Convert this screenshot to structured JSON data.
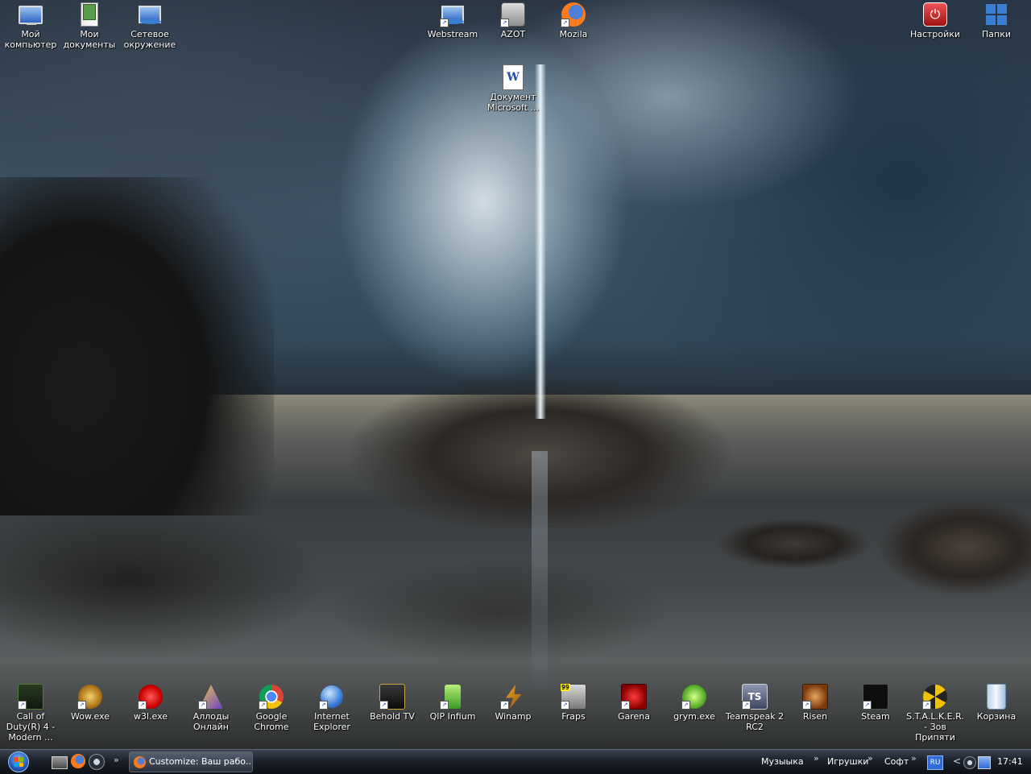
{
  "desktop": {
    "icons_top": [
      {
        "label": "Мой компьютер",
        "icon": "my-computer-icon"
      },
      {
        "label": "Мои документы",
        "icon": "my-documents-icon"
      },
      {
        "label": "Сетевое окружение",
        "icon": "network-icon"
      },
      {
        "label": "Webstream",
        "icon": "webstream-icon"
      },
      {
        "label": "AZOT",
        "icon": "azot-icon"
      },
      {
        "label": "Mozila",
        "icon": "firefox-icon"
      },
      {
        "label": "Документ Microsoft ...",
        "icon": "word-document-icon"
      },
      {
        "label": "Настройки",
        "icon": "power-settings-icon"
      },
      {
        "label": "Папки",
        "icon": "windows-folders-icon"
      }
    ],
    "icons_bottom": [
      {
        "label": "Call of Duty(R) 4 - Modern ...",
        "icon": "call-of-duty-icon"
      },
      {
        "label": "Wow.exe",
        "icon": "wow-icon"
      },
      {
        "label": "w3l.exe",
        "icon": "w3l-icon"
      },
      {
        "label": "Аллоды Онлайн",
        "icon": "allods-icon"
      },
      {
        "label": "Google Chrome",
        "icon": "chrome-icon"
      },
      {
        "label": "Internet Explorer",
        "icon": "internet-explorer-icon"
      },
      {
        "label": "Behold TV",
        "icon": "behold-tv-icon"
      },
      {
        "label": "QIP Infium",
        "icon": "qip-icon"
      },
      {
        "label": "Winamp",
        "icon": "winamp-icon"
      },
      {
        "label": "Fraps",
        "icon": "fraps-icon"
      },
      {
        "label": "Garena",
        "icon": "garena-icon"
      },
      {
        "label": "grym.exe",
        "icon": "grym-icon"
      },
      {
        "label": "Teamspeak 2 RC2",
        "icon": "teamspeak-icon"
      },
      {
        "label": "Risen",
        "icon": "risen-icon"
      },
      {
        "label": "Steam",
        "icon": "steam-icon"
      },
      {
        "label": "S.T.A.L.K.E.R. - Зов Припяти",
        "icon": "stalker-icon"
      },
      {
        "label": "Корзина",
        "icon": "recycle-bin-icon"
      }
    ],
    "fraps_badge": "99"
  },
  "taskbar": {
    "active_window": "Customize: Ваш рабо...",
    "toolbars": [
      "Музыыка",
      "Игрушки",
      "Софт"
    ],
    "language": "RU",
    "clock": "17:41",
    "chevron": "»",
    "tray_expand": "<"
  },
  "colors": {
    "taskbar_top": "#3c4452",
    "taskbar_bottom": "#0d1016",
    "icon_label": "#ffffff",
    "xp_blue": "#2f66c6"
  }
}
